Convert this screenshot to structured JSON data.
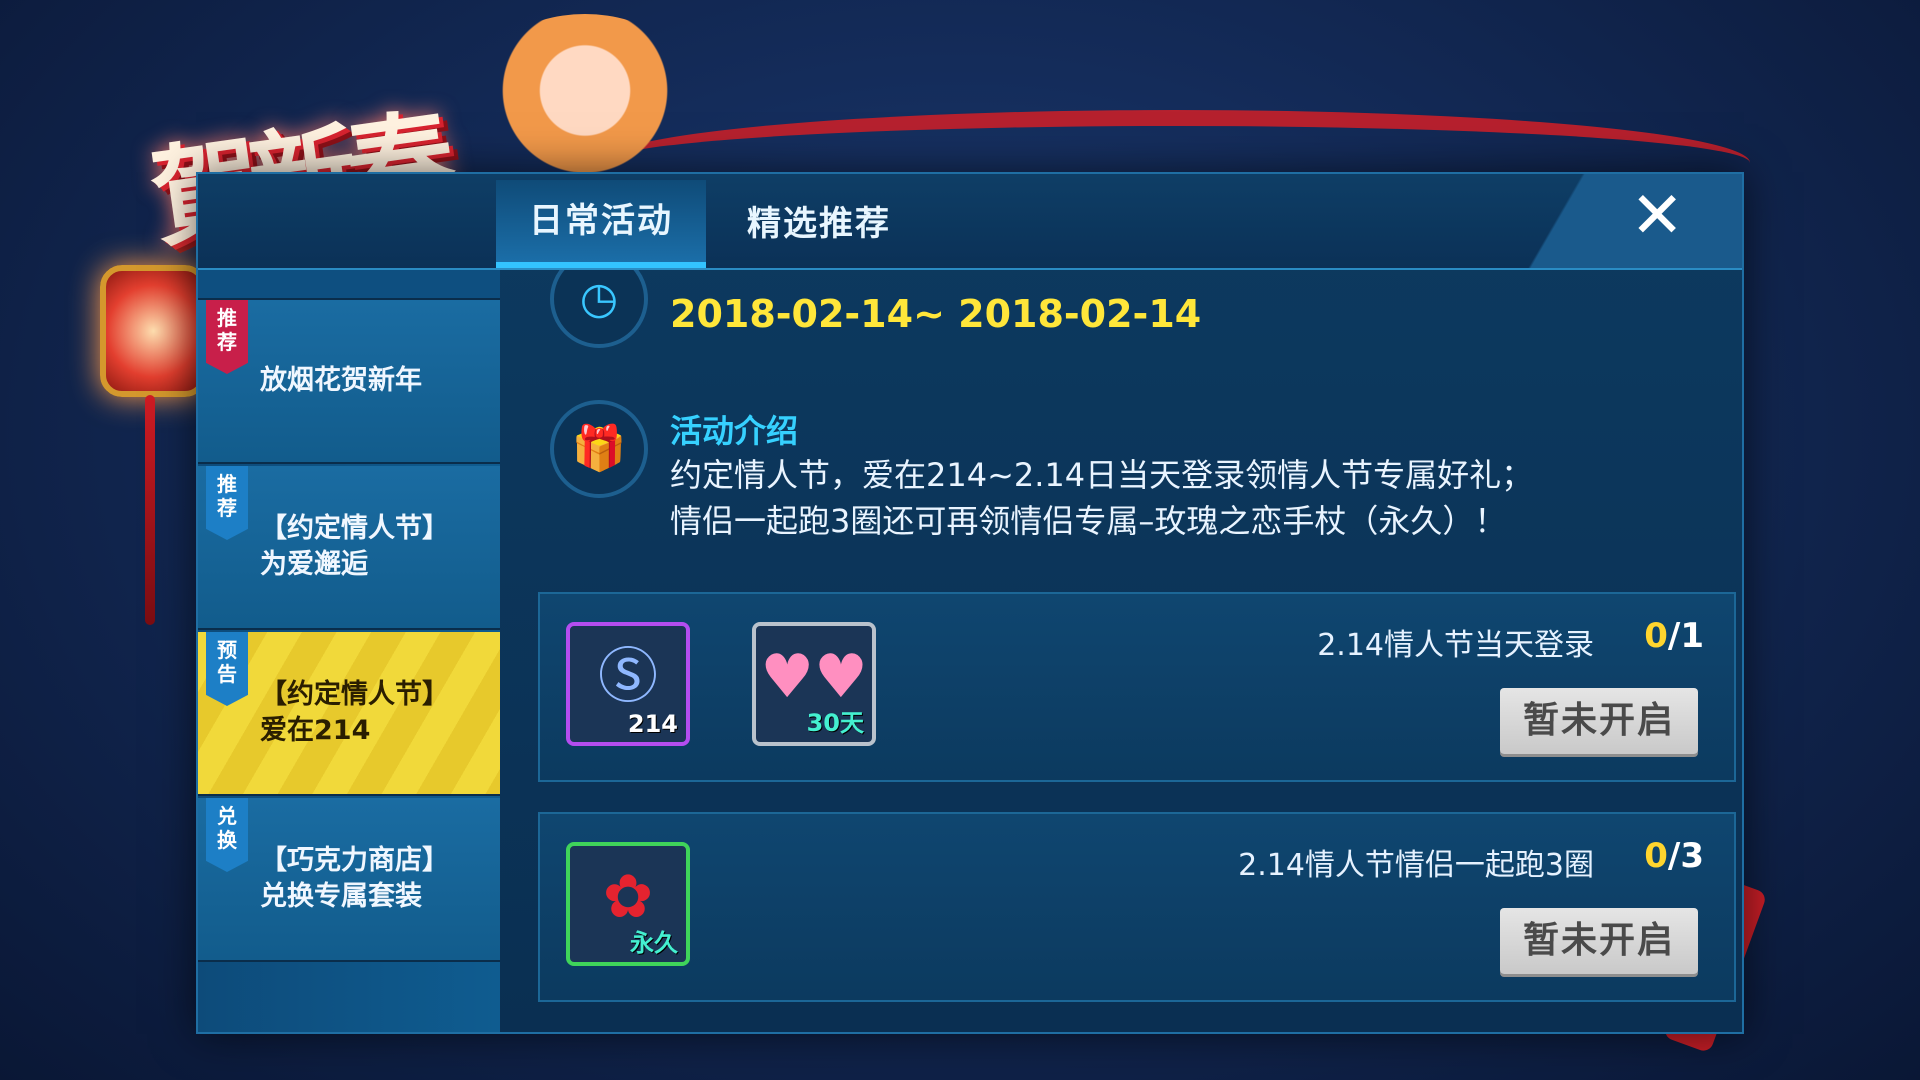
{
  "brand": {
    "logo_text": "賀新春"
  },
  "tabs": [
    {
      "label": "日常活动",
      "active": true
    },
    {
      "label": "精选推荐",
      "active": false
    }
  ],
  "close_icon": "close-icon",
  "sidebar": {
    "items": [
      {
        "badge": "推\n荐",
        "badge_color": "#c81f4a",
        "label": "放烟花贺新年",
        "active": false
      },
      {
        "badge": "推\n荐",
        "badge_color": "#1d7fc6",
        "label": "【约定情人节】\n为爱邂逅",
        "active": false
      },
      {
        "badge": "预\n告",
        "badge_color": "#1d7fc6",
        "label": "【约定情人节】\n爱在214",
        "active": true
      },
      {
        "badge": "兑\n换",
        "badge_color": "#1d7fc6",
        "label": "【巧克力商店】\n兑换专属套装",
        "active": false
      }
    ]
  },
  "activity": {
    "time_value": "2018-02-14~ 2018-02-14",
    "intro_label": "活动介绍",
    "intro_text": "约定情人节，爱在214~2.14日当天登录领情人节专属好礼；\n情侣一起跑3圈还可再领情侣专属–玫瑰之恋手杖（永久）！"
  },
  "tasks": [
    {
      "title": "2.14情人节当天登录",
      "progress_current": "0",
      "progress_total": "/1",
      "button_label": "暂未开启",
      "rewards": [
        {
          "icon": "s-coin-card-icon",
          "tag": "214",
          "rarity": "purple"
        },
        {
          "icon": "hearts-effect-icon",
          "tag": "30天",
          "rarity": "gray"
        }
      ]
    },
    {
      "title": "2.14情人节情侣一起跑3圈",
      "progress_current": "0",
      "progress_total": "/3",
      "button_label": "暂未开启",
      "rewards": [
        {
          "icon": "rose-cane-icon",
          "tag": "永久",
          "rarity": "green"
        }
      ]
    }
  ],
  "colors": {
    "accent_cyan": "#36d1ff",
    "time_yellow": "#ffe63a",
    "active_tab_yellow": "#f1d93a"
  }
}
